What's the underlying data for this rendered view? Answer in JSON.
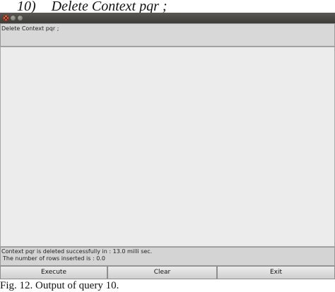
{
  "heading": {
    "number": "10)",
    "text": "Delete Context pqr ;"
  },
  "window": {
    "controls": {
      "close_icon": "close-icon",
      "minimize_icon": "minimize-icon",
      "maximize_icon": "maximize-icon"
    },
    "query_area": {
      "text": "Delete Context pqr ;"
    },
    "output_area": {
      "text": ""
    },
    "status": {
      "line1": "Context pqr is deleted successfully in : 13.0 milli sec.",
      "line2": "The number of rows inserted is : 0.0"
    },
    "buttons": {
      "execute_label": "Execute",
      "clear_label": "Clear",
      "exit_label": "Exit"
    }
  },
  "caption": "Fig. 12. Output of query 10."
}
